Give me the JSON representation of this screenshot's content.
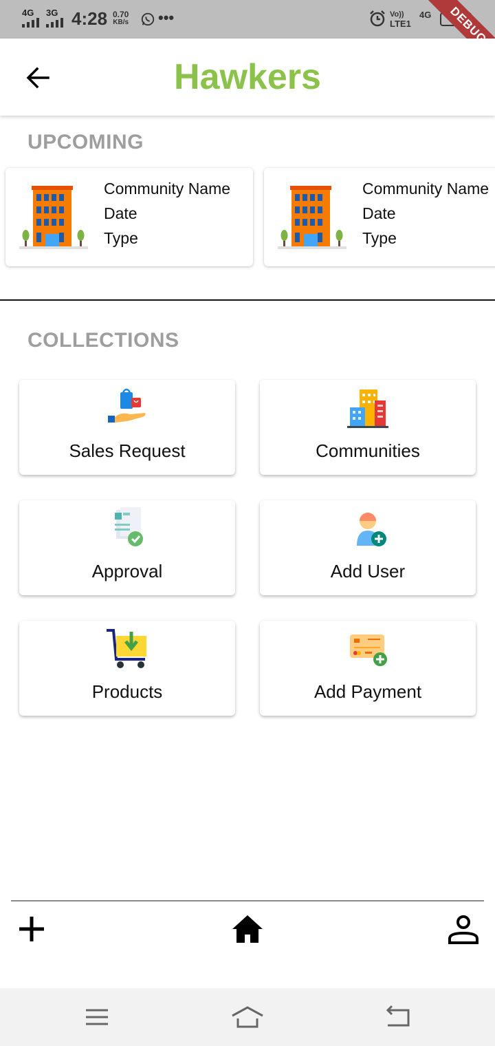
{
  "status_bar": {
    "network1": "4G",
    "network2": "3G",
    "time": "4:28",
    "speed_value": "0.70",
    "speed_unit": "KB/s",
    "more": "•••",
    "volte_line1": "Vo))",
    "volte_line2": "LTE1",
    "network3": "4G",
    "debug_banner": "DEBUG"
  },
  "app_bar": {
    "title": "Hawkers",
    "title_color": "#8bc34a",
    "back_icon": "arrow-left-icon"
  },
  "upcoming": {
    "title": "UPCOMING",
    "cards": [
      {
        "icon": "building-icon",
        "name": "Community Name",
        "date": "Date",
        "type": "Type"
      },
      {
        "icon": "building-icon",
        "name": "Community Name",
        "date": "Date",
        "type": "Type"
      }
    ]
  },
  "collections": {
    "title": "COLLECTIONS",
    "items": [
      {
        "label": "Sales Request",
        "icon": "shopping-hand-icon"
      },
      {
        "label": "Communities",
        "icon": "city-buildings-icon"
      },
      {
        "label": "Approval",
        "icon": "approved-document-icon"
      },
      {
        "label": "Add User",
        "icon": "add-user-icon"
      },
      {
        "label": "Products",
        "icon": "cart-download-icon"
      },
      {
        "label": "Add Payment",
        "icon": "add-card-icon"
      }
    ]
  },
  "bottom_nav": {
    "items": [
      {
        "icon": "plus-icon"
      },
      {
        "icon": "home-icon"
      },
      {
        "icon": "person-icon"
      }
    ]
  },
  "system_nav": {
    "items": [
      {
        "icon": "menu-icon"
      },
      {
        "icon": "home-outline-icon"
      },
      {
        "icon": "back-icon"
      }
    ]
  }
}
